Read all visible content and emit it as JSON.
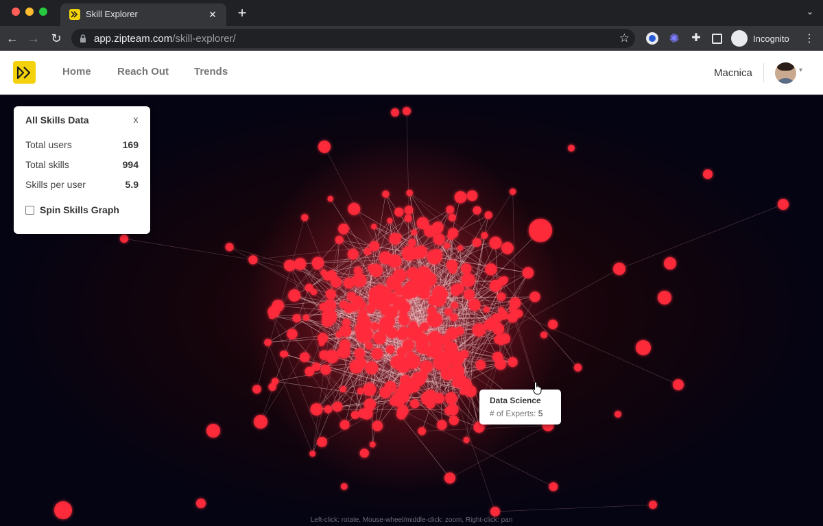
{
  "browser": {
    "tab_title": "Skill Explorer",
    "tab_close": "✕",
    "new_tab": "+",
    "url_host": "app.zipteam.com",
    "url_path": "/skill-explorer/",
    "profile_label": "Incognito"
  },
  "header": {
    "nav": [
      "Home",
      "Reach Out",
      "Trends"
    ],
    "org_name": "Macnica"
  },
  "panel": {
    "title": "All Skills Data",
    "close": "x",
    "stats": [
      {
        "label": "Total users",
        "value": "169"
      },
      {
        "label": "Total skills",
        "value": "994"
      },
      {
        "label": "Skills per user",
        "value": "5.9"
      }
    ],
    "spin_label": "Spin Skills Graph",
    "spin_checked": false
  },
  "tooltip": {
    "title": "Data Science",
    "label": "# of Experts: ",
    "value": "5"
  },
  "hint": "Left-click: rotate, Mouse-wheel/middle-click: zoom, Right-click: pan",
  "colors": {
    "brand_yellow": "#f4d20b",
    "node_red": "#ff2a3c",
    "graph_background": "#050412"
  },
  "icons": {
    "logo": "double-chevron-right-icon",
    "back": "arrow-left-icon",
    "forward": "arrow-right-icon",
    "reload": "reload-icon",
    "lock": "lock-icon",
    "bookmark": "star-icon",
    "profile": "incognito-icon"
  }
}
